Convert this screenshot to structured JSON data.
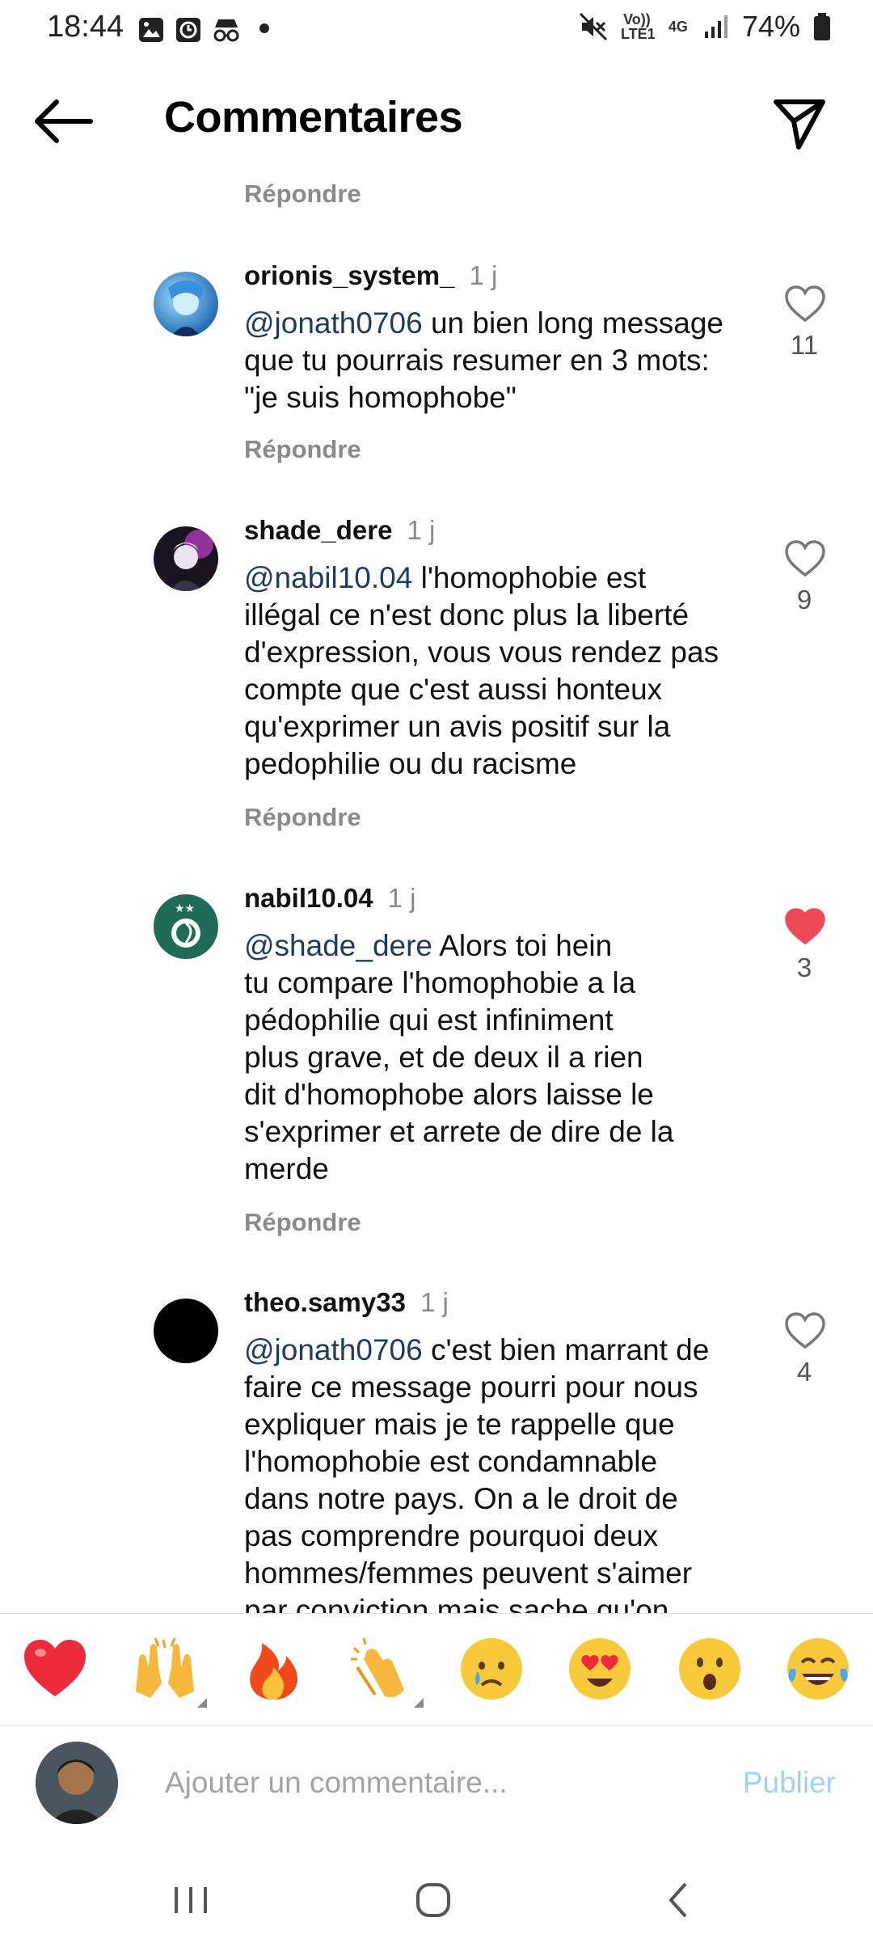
{
  "status_bar": {
    "time": "18:44",
    "battery": "74%",
    "network_volte": "Vo)) LTE1",
    "network_4g": "4G",
    "icons": [
      "image-icon",
      "alarm-icon",
      "incognito-icon",
      "dot-icon",
      "mute-icon",
      "signal-icon",
      "battery-icon"
    ]
  },
  "header": {
    "title": "Commentaires"
  },
  "top_reply_label": "Répondre",
  "comments": [
    {
      "username": "orionis_system_",
      "time": "1 j",
      "mention": "@jonath0706",
      "lines": [
        " un bien long message",
        "que tu pourrais resumer en 3 mots:",
        "\"je suis homophobe\""
      ],
      "likes": "11",
      "liked": false,
      "reply_label": "Répondre"
    },
    {
      "username": "shade_dere",
      "time": "1 j",
      "mention": "@nabil10.04",
      "lines": [
        " l'homophobie est",
        "illégal ce n'est donc plus la liberté",
        "d'expression, vous vous rendez pas",
        "compte que c'est aussi honteux",
        "qu'exprimer un avis positif sur la",
        "pedophilie ou du racisme"
      ],
      "likes": "9",
      "liked": false,
      "reply_label": "Répondre"
    },
    {
      "username": "nabil10.04",
      "time": "1 j",
      "mention": "@shade_dere",
      "lines": [
        " Alors toi hein",
        "tu compare l'homophobie a la",
        "pédophilie qui est infiniment",
        "plus grave, et de deux il a rien",
        "dit d'homophobe alors laisse le",
        "s'exprimer et arrete de dire de la",
        "merde"
      ],
      "likes": "3",
      "liked": true,
      "reply_label": "Répondre"
    },
    {
      "username": "theo.samy33",
      "time": "1 j",
      "mention": "@jonath0706",
      "lines": [
        " c'est bien marrant de",
        "faire ce message pourri pour nous",
        "expliquer mais je te rappelle que",
        "l'homophobie est condamnable",
        "dans notre pays. On a le droit de",
        "pas comprendre pourquoi deux",
        "hommes/femmes peuvent s'aimer",
        "par conviction mais sache qu'on"
      ],
      "likes": "4",
      "liked": false,
      "reply_label": ""
    }
  ],
  "emoji_bar": [
    "❤️",
    "🙌",
    "🔥",
    "👏",
    "😢",
    "😍",
    "😮",
    "😂"
  ],
  "composer": {
    "placeholder": "Ajouter un commentaire...",
    "publish_label": "Publier"
  },
  "colors": {
    "like_red": "#ed4956",
    "mention": "#1f3b60",
    "muted": "#8a8a8a",
    "publish_disabled": "#9fd2f5"
  }
}
